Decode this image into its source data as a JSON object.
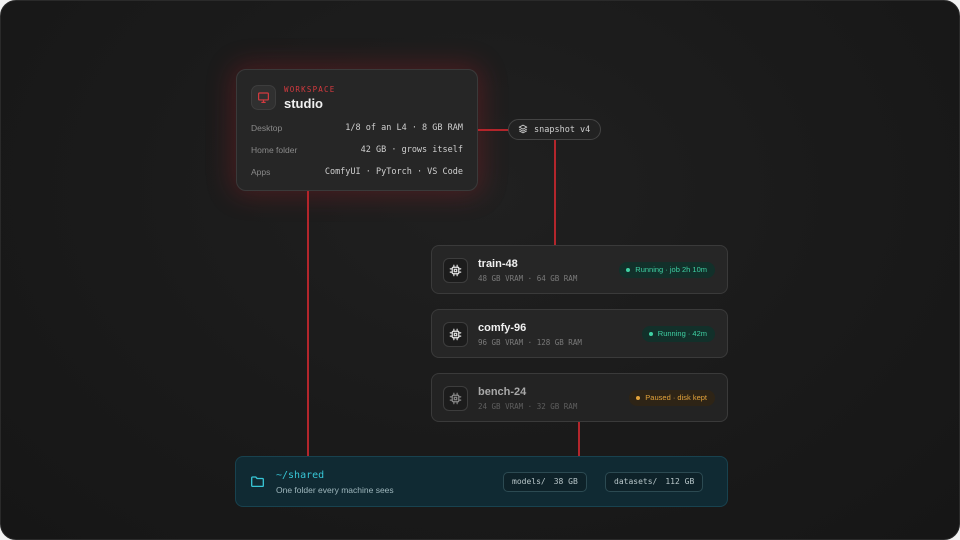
{
  "workspace": {
    "kicker": "WORKSPACE",
    "title": "studio",
    "rows": [
      {
        "key": "Desktop",
        "value": "1/8 of an L4 · 8 GB RAM"
      },
      {
        "key": "Home folder",
        "value": "42 GB · grows itself"
      },
      {
        "key": "Apps",
        "value": "ComfyUI · PyTorch · VS Code"
      }
    ]
  },
  "snapshot": {
    "label": "snapshot v4",
    "icon": "layers-icon"
  },
  "machines": [
    {
      "name": "train-48",
      "spec_vram": "48 GB VRAM",
      "spec_ram": "64 GB RAM",
      "status": "Running · job 2h 10m",
      "state": "running",
      "icon": "chip-icon"
    },
    {
      "name": "comfy-96",
      "spec_vram": "96 GB VRAM",
      "spec_ram": "128 GB RAM",
      "status": "Running · 42m",
      "state": "running",
      "icon": "chip-icon"
    },
    {
      "name": "bench-24",
      "spec_vram": "24 GB VRAM",
      "spec_ram": "32 GB RAM",
      "status": "Paused · disk kept",
      "state": "paused",
      "icon": "chip-icon"
    }
  ],
  "shared": {
    "path": "~/shared",
    "subtitle": "One folder every machine sees",
    "icon": "folder-icon",
    "chips": [
      {
        "name": "models/",
        "size": "38 GB"
      },
      {
        "name": "datasets/",
        "size": "112 GB"
      }
    ]
  },
  "colors": {
    "accent_red": "#d33a3f",
    "connector": "#b3262c",
    "running_green": "#3fd1a4",
    "paused_amber": "#e2a23b",
    "shared_cyan": "#37c6d6"
  }
}
